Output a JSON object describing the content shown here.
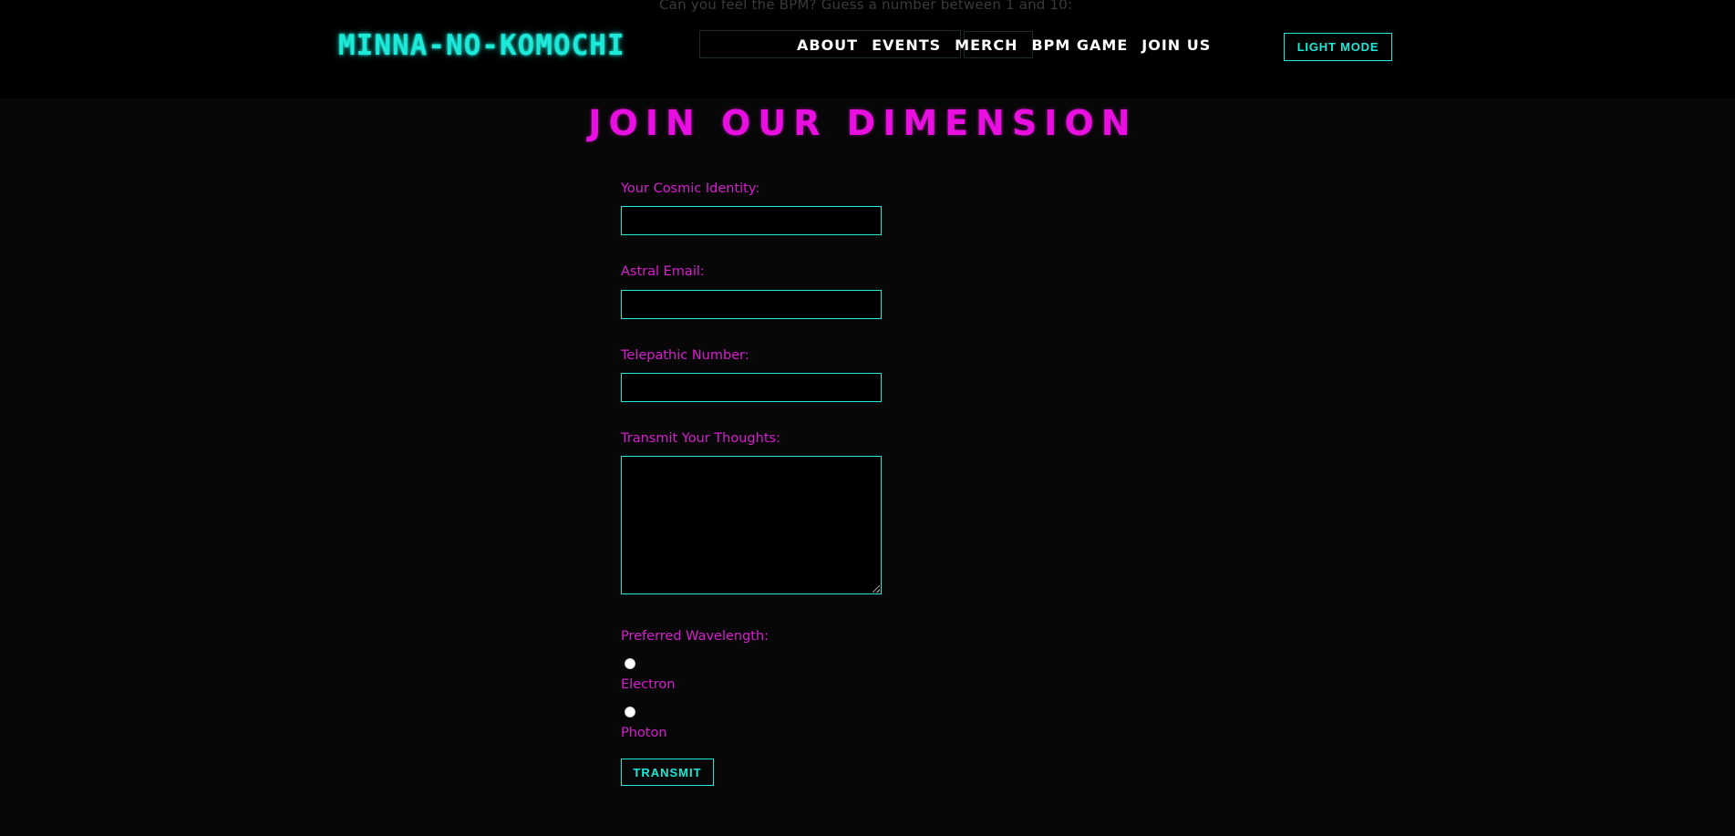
{
  "header": {
    "bpm_hint": "Can you feel the BPM? Guess a number between 1 and 10:",
    "logo": "MINNA-NO-KOMOCHI",
    "nav": [
      "ABOUT",
      "EVENTS",
      "MERCH",
      "BPM GAME",
      "JOIN US"
    ],
    "mode_button": "LIGHT MODE"
  },
  "form": {
    "title": "JOIN OUR DIMENSION",
    "name_label": "Your Cosmic Identity:",
    "email_label": "Astral Email:",
    "phone_label": "Telepathic Number:",
    "message_label": "Transmit Your Thoughts:",
    "wavelength_label": "Preferred Wavelength:",
    "options": [
      "Electron",
      "Photon"
    ],
    "submit": "TRANSMIT"
  },
  "colors": {
    "accent_cyan": "#1de9d8",
    "accent_magenta": "#e80fe0",
    "background": "#070707"
  }
}
